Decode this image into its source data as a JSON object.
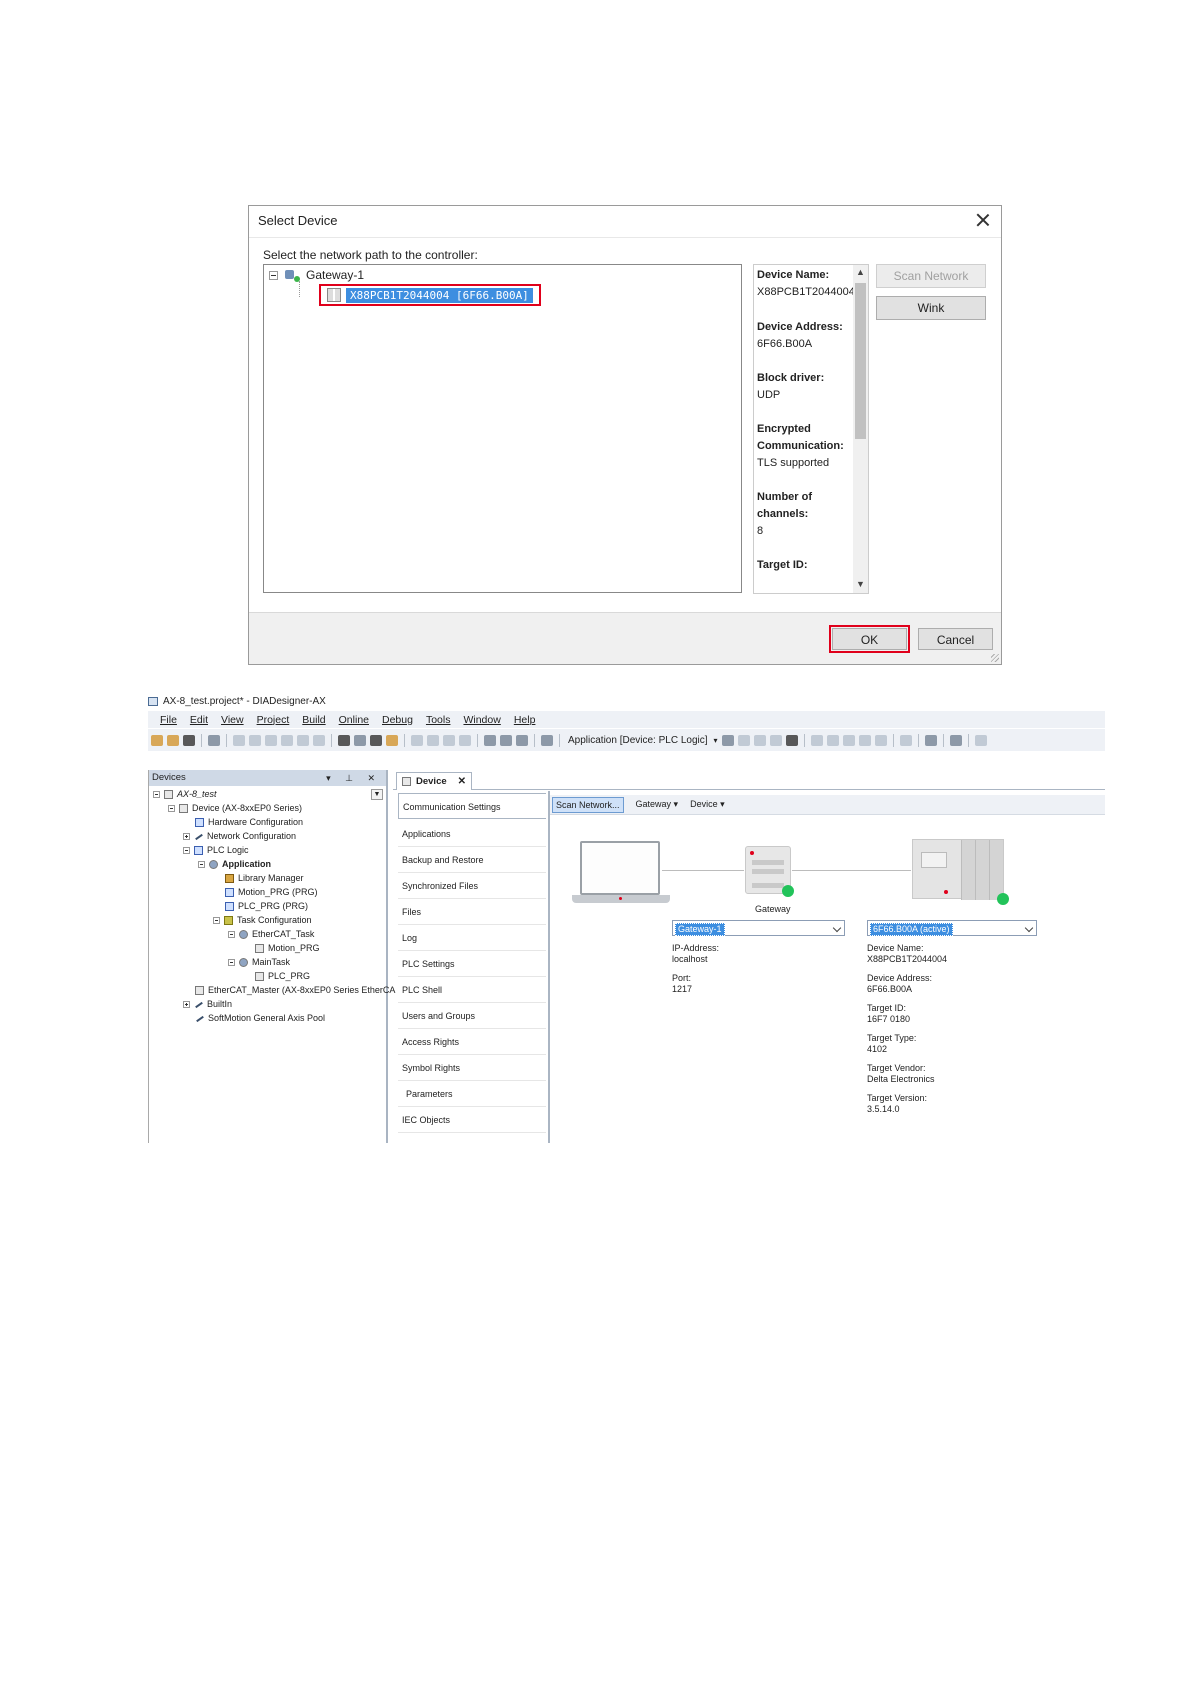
{
  "dialog": {
    "title": "Select Device",
    "prompt": "Select the network path to the controller:",
    "tree": {
      "gateway": "Gateway-1",
      "device": "X88PCB1T2044004 [6F66.B00A]"
    },
    "info": [
      {
        "key": "Device Name:",
        "value": "X88PCB1T2044004"
      },
      {
        "key": "Device Address:",
        "value": "6F66.B00A"
      },
      {
        "key": "Block driver:",
        "value": "UDP"
      },
      {
        "key": "Encrypted Communication:",
        "value": "TLS supported"
      },
      {
        "key": "Number of channels:",
        "value": "8"
      },
      {
        "key": "Target ID:",
        "value": ""
      }
    ],
    "buttons": {
      "scan": "Scan Network",
      "wink": "Wink",
      "ok": "OK",
      "cancel": "Cancel"
    }
  },
  "ide": {
    "window_title": "AX-8_test.project* - DIADesigner-AX",
    "menu": [
      "File",
      "Edit",
      "View",
      "Project",
      "Build",
      "Online",
      "Debug",
      "Tools",
      "Window",
      "Help"
    ],
    "toolbar_app": "Application [Device: PLC Logic]",
    "devices_panel": {
      "title": "Devices",
      "controls": "▾ ⊥ ✕",
      "tree": [
        {
          "label": "AX-8_test"
        },
        {
          "label": "Device (AX-8xxEP0 Series)"
        },
        {
          "label": "Hardware Configuration"
        },
        {
          "label": "Network Configuration"
        },
        {
          "label": "PLC Logic"
        },
        {
          "label": "Application"
        },
        {
          "label": "Library Manager"
        },
        {
          "label": "Motion_PRG (PRG)"
        },
        {
          "label": "PLC_PRG (PRG)"
        },
        {
          "label": "Task Configuration"
        },
        {
          "label": "EtherCAT_Task"
        },
        {
          "label": "Motion_PRG"
        },
        {
          "label": "MainTask"
        },
        {
          "label": "PLC_PRG"
        },
        {
          "label": "EtherCAT_Master (AX-8xxEP0 Series EtherCA"
        },
        {
          "label": "BuiltIn"
        },
        {
          "label": "SoftMotion General Axis Pool"
        }
      ]
    },
    "editor_tab": "Device",
    "side_tabs": [
      "Communication Settings",
      "Applications",
      "Backup and Restore",
      "Synchronized Files",
      "Files",
      "Log",
      "PLC Settings",
      "PLC Shell",
      "Users and Groups",
      "Access Rights",
      "Symbol Rights",
      "Parameters",
      "IEC Objects"
    ],
    "comm": {
      "scan_button": "Scan Network...",
      "gateway_menu": "Gateway ▾",
      "device_menu": "Device ▾",
      "gateway_label": "Gateway",
      "gateway_combo": "Gateway-1",
      "device_combo": "6F66.B00A (active)",
      "gateway_info": [
        {
          "key": "IP-Address:",
          "value": "localhost"
        },
        {
          "key": "Port:",
          "value": "1217"
        }
      ],
      "device_info": [
        {
          "key": "Device Name:",
          "value": "X88PCB1T2044004"
        },
        {
          "key": "Device Address:",
          "value": "6F66.B00A"
        },
        {
          "key": "Target ID:",
          "value": "16F7 0180"
        },
        {
          "key": "Target Type:",
          "value": "4102"
        },
        {
          "key": "Target Vendor:",
          "value": "Delta Electronics"
        },
        {
          "key": "Target Version:",
          "value": "3.5.14.0"
        }
      ],
      "status_color": "#22c35a"
    }
  }
}
